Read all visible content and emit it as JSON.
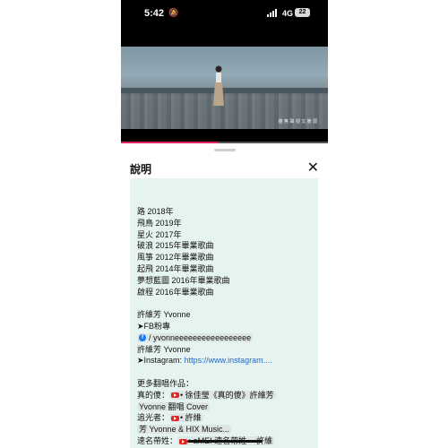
{
  "status_bar": {
    "time": "5:42",
    "bell_icon": "bell-slash-icon",
    "signal_icon": "cellular-signal-icon",
    "network": "4G",
    "battery": "22"
  },
  "video": {
    "subtitle": "雖 無 聲 卻 又 脆 弱",
    "progress_percent": 47
  },
  "sheet": {
    "title": "說明",
    "close_icon": "close-icon"
  },
  "description": {
    "songs": [
      "路 2018年",
      "飛鳥 2019年",
      "星火 2017年",
      "破浪 2015年畢業歌曲",
      "風箏 2012年畢業歌曲",
      "起飛 2014年畢業歌曲",
      "夢想藍圖 2016年畢業歌曲",
      "啟程 2016年畢業歌曲"
    ],
    "artist": "許維芳 Yvonne",
    "fb_heading": "➤FB粉專",
    "fb_link": "/ yvonneeeeeeeeeeeeeeeee",
    "artist_again": "許維芳 Yvonne",
    "instagram_label": "➤Instagram: ",
    "instagram_link": "https://www.instagram....",
    "more_heading": "更多翻唱作品：",
    "cover1_prefix": "真的傻：",
    "cover1_chip": "• 徐佳瑩《真的傻》許維芳",
    "cover1_line2": "Yvonne 翻唱 Cover",
    "cover2_prefix": "追光者：",
    "cover2_chip": "• 許維",
    "cover2_line2": "芳 Yvonne & HIX Music...",
    "cover3_prefix": "速名帶姓：",
    "cover3_chip": "• aMEI 速名帶姓 -- 許維"
  }
}
